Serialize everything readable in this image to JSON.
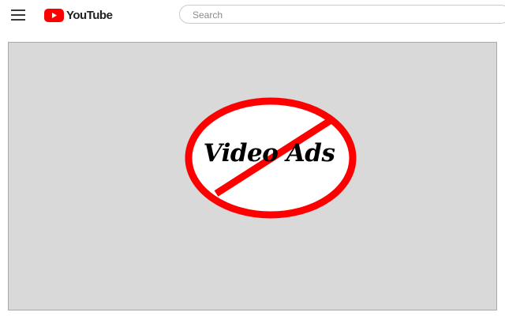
{
  "header": {
    "logo_text": "YouTube",
    "search": {
      "placeholder": "Search",
      "value": ""
    }
  },
  "player": {
    "overlay_text": "Video Ads",
    "overlay_icon": "no-video-ads-prohibition-sign"
  },
  "colors": {
    "brand_red": "#ff0000",
    "player_bg": "#d9d9d9",
    "prohibition_red": "#ff0000"
  }
}
